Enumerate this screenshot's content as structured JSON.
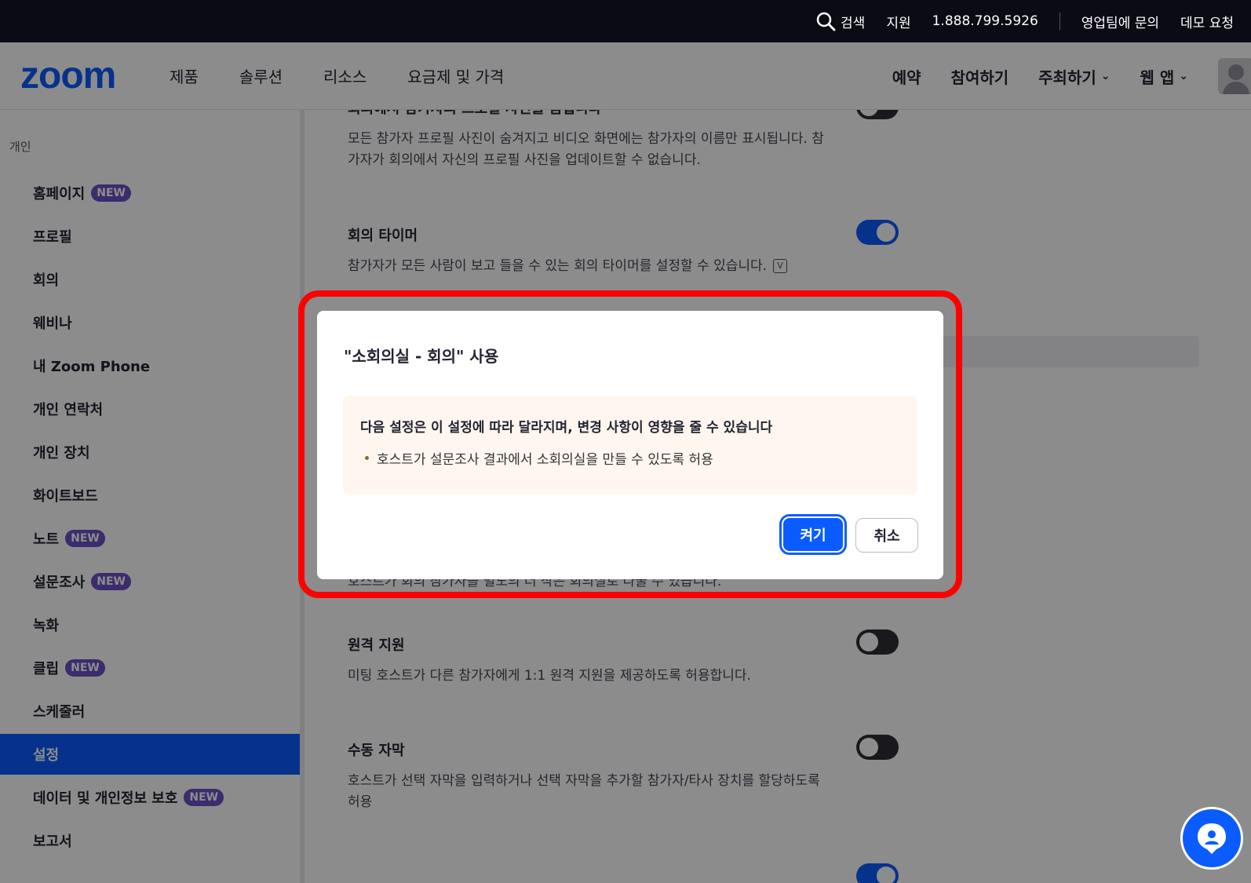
{
  "topbar": {
    "search": "검색",
    "support": "지원",
    "phone": "1.888.799.5926",
    "contact_sales": "영업팀에 문의",
    "demo": "데모 요청"
  },
  "nav": {
    "logo": "zoom",
    "left": [
      "제품",
      "솔루션",
      "리소스",
      "요금제 및 가격"
    ],
    "schedule": "예약",
    "join": "참여하기",
    "host": "주최하기",
    "web_app": "웹 앱"
  },
  "sidebar": {
    "section": "개인",
    "badge": "NEW",
    "items": [
      {
        "label": "홈페이지",
        "new": true
      },
      {
        "label": "프로필",
        "new": false
      },
      {
        "label": "회의",
        "new": false
      },
      {
        "label": "웨비나",
        "new": false
      },
      {
        "label": "내 Zoom Phone",
        "new": false
      },
      {
        "label": "개인 연락처",
        "new": false
      },
      {
        "label": "개인 장치",
        "new": false
      },
      {
        "label": "화이트보드",
        "new": false
      },
      {
        "label": "노트",
        "new": true
      },
      {
        "label": "설문조사",
        "new": true
      },
      {
        "label": "녹화",
        "new": false
      },
      {
        "label": "클립",
        "new": true
      },
      {
        "label": "스케줄러",
        "new": false
      },
      {
        "label": "설정",
        "new": false,
        "active": true
      },
      {
        "label": "데이터 및 개인정보 보호",
        "new": true
      },
      {
        "label": "보고서",
        "new": false
      }
    ]
  },
  "settings": {
    "profile_hide_title": "회의에서 참가자의 프로필 사진을 숨깁니다",
    "profile_hide_desc": "모든 참가자 프로필 사진이 숨겨지고 비디오 화면에는 참가자의 이름만 표시됩니다. 참가자가 회의에서 자신의 프로필 사진을 업데이트할 수 없습니다.",
    "timer_title": "회의 타이머",
    "timer_desc": "참가자가 모든 사람이 보고 들을 수 있는 회의 타이머를 설정할 수 있습니다.",
    "timer_icon": "V",
    "breakout_desc_partial": "호스트가 회의 참가자를 별도의 더 작은 회의실로 나눌 수 있습니다.",
    "remote_title": "원격 지원",
    "remote_desc": "미팅 호스트가 다른 참가자에게 1:1 원격 지원을 제공하도록 허용합니다.",
    "caption_title": "수동 자막",
    "caption_desc": "호스트가 선택 자막을 입력하거나 선택 자막을 추가할 참가자/타사 장치를 할당하도록 허용"
  },
  "dialog": {
    "title": "\"소회의실 - 회의\" 사용",
    "box_head": "다음 설정은 이 설정에 따라 달라지며, 변경 사항이 영향을 줄 수 있습니다",
    "box_item": "호스트가 설문조사 결과에서 소회의실을 만들 수 있도록 허용",
    "confirm": "켜기",
    "cancel": "취소"
  },
  "colors": {
    "brand": "#0b5cff",
    "highlight": "#ff0000",
    "badge": "#6e4fc6"
  }
}
